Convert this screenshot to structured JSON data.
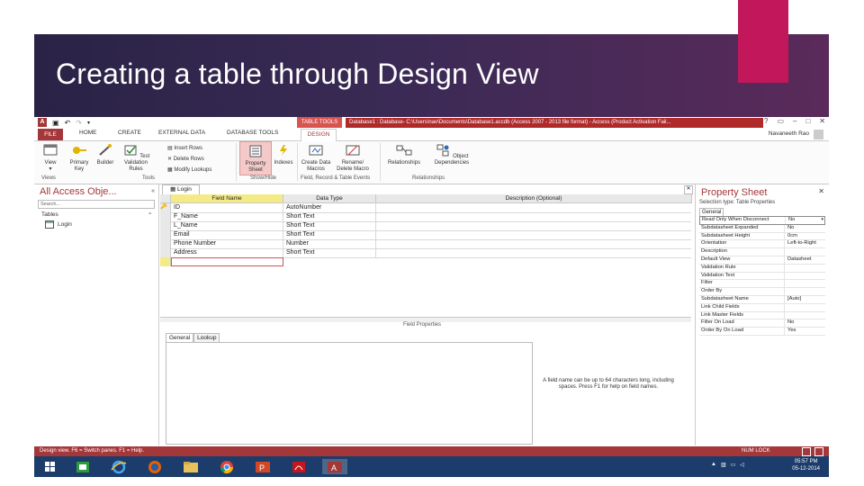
{
  "slide": {
    "title": "Creating a table through Design View",
    "colors": {
      "banner": "#2a2346",
      "accent": "#c2185b"
    }
  },
  "app": {
    "context_label": "TABLE TOOLS",
    "window_title": "Database1 : Database- C:\\Users\\nav\\Documents\\Database1.accdb (Access 2007 - 2013 file format) - Access (Product Activation Fail...",
    "user": "Navaneeth Rao",
    "tabs": [
      "FILE",
      "HOME",
      "CREATE",
      "EXTERNAL DATA",
      "DATABASE TOOLS",
      "DESIGN"
    ],
    "ribbon": {
      "view": "View",
      "primary_key": "Primary Key",
      "builder": "Builder",
      "test_validation": "Test Validation Rules",
      "insert_rows": "Insert Rows",
      "delete_rows": "Delete Rows",
      "modify_lookups": "Modify Lookups",
      "property_sheet": "Property Sheet",
      "indexes": "Indexes",
      "create_data_macros": "Create Data Macros",
      "rename_delete_macro": "Rename/ Delete Macro",
      "relationships": "Relationships",
      "object_dependencies": "Object Dependencies",
      "groups": [
        "Views",
        "Tools",
        "Show/Hide",
        "Field, Record & Table Events",
        "Relationships"
      ]
    },
    "nav": {
      "title": "All Access Obje...",
      "search_placeholder": "Search...",
      "section": "Tables",
      "items": [
        "Login"
      ]
    },
    "doc_tab": "Login",
    "grid": {
      "headers": [
        "Field Name",
        "Data Type",
        "Description (Optional)"
      ],
      "rows": [
        {
          "field": "ID",
          "type": "AutoNumber"
        },
        {
          "field": "F_Name",
          "type": "Short Text"
        },
        {
          "field": "L_Name",
          "type": "Short Text"
        },
        {
          "field": "Email",
          "type": "Short Text"
        },
        {
          "field": "Phone Number",
          "type": "Number"
        },
        {
          "field": "Address",
          "type": "Short Text"
        },
        {
          "field": "",
          "type": ""
        }
      ]
    },
    "field_properties": {
      "label": "Field Properties",
      "tabs": [
        "General",
        "Lookup"
      ],
      "help": "A field name can be up to 64 characters long, including spaces. Press F1 for help on field names."
    },
    "property_sheet": {
      "title": "Property Sheet",
      "selection_type": "Selection type: Table Properties",
      "tab": "General",
      "rows": [
        {
          "k": "Read Only When Disconnect",
          "v": "No"
        },
        {
          "k": "Subdatasheet Expanded",
          "v": "No"
        },
        {
          "k": "Subdatasheet Height",
          "v": "0cm"
        },
        {
          "k": "Orientation",
          "v": "Left-to-Right"
        },
        {
          "k": "Description",
          "v": ""
        },
        {
          "k": "Default View",
          "v": "Datasheet"
        },
        {
          "k": "Validation Rule",
          "v": ""
        },
        {
          "k": "Validation Text",
          "v": ""
        },
        {
          "k": "Filter",
          "v": ""
        },
        {
          "k": "Order By",
          "v": ""
        },
        {
          "k": "Subdatasheet Name",
          "v": "[Auto]"
        },
        {
          "k": "Link Child Fields",
          "v": ""
        },
        {
          "k": "Link Master Fields",
          "v": ""
        },
        {
          "k": "Filter On Load",
          "v": "No"
        },
        {
          "k": "Order By On Load",
          "v": "Yes"
        }
      ]
    },
    "status": {
      "left": "Design view. F6 = Switch panes. F1 = Help.",
      "right": "NUM LOCK"
    },
    "taskbar": {
      "clock_time": "05:57 PM",
      "clock_date": "05-12-2014"
    }
  }
}
